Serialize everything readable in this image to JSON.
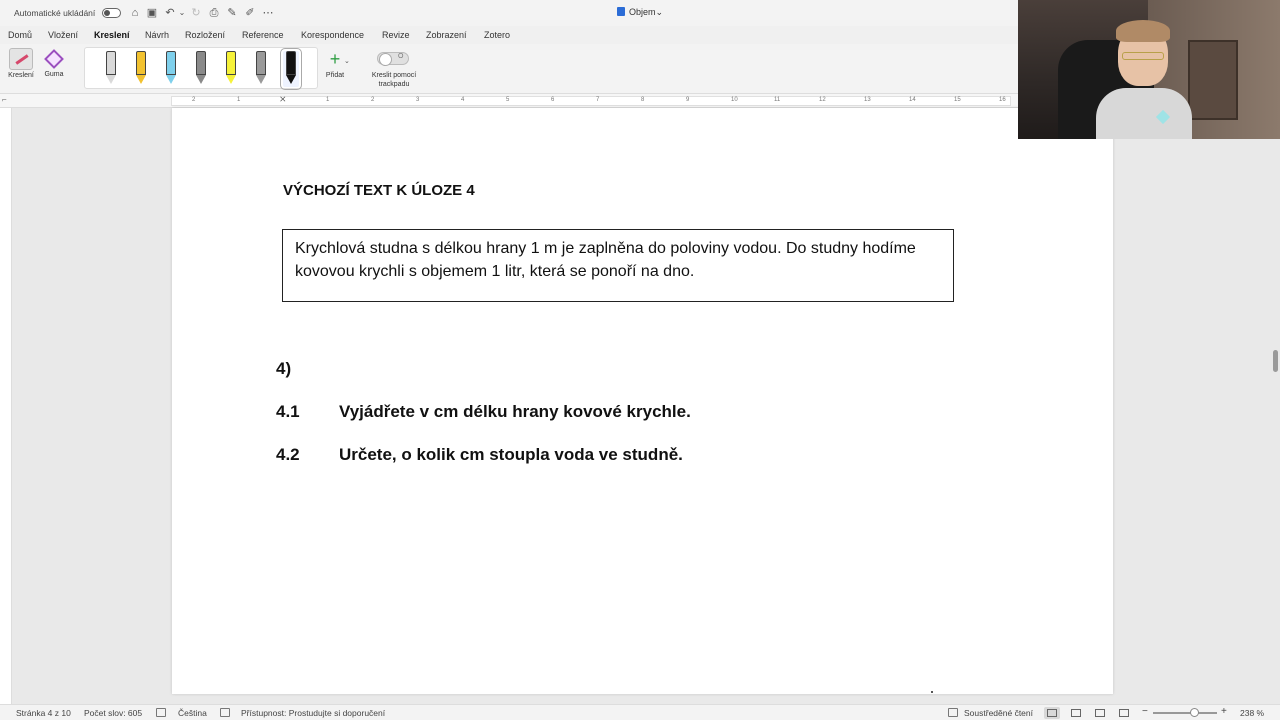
{
  "titlebar": {
    "autosave_label": "Automatické ukládání",
    "document_title": "Objem",
    "title_chevron": "⌄"
  },
  "ribbon_tabs": [
    {
      "label": "Domů"
    },
    {
      "label": "Vložení"
    },
    {
      "label": "Kreslení"
    },
    {
      "label": "Návrh"
    },
    {
      "label": "Rozložení"
    },
    {
      "label": "Reference"
    },
    {
      "label": "Korespondence"
    },
    {
      "label": "Revize"
    },
    {
      "label": "Zobrazení"
    },
    {
      "label": "Zotero"
    }
  ],
  "ribbon": {
    "drawing_label": "Kreslení",
    "eraser_label": "Guma",
    "add_label": "Přidat",
    "trackpad_label": "Kreslit pomocí trackpadu",
    "trackpad_state": "O",
    "pens": [
      {
        "color": "#d9d9d9"
      },
      {
        "color": "#f2c230"
      },
      {
        "color": "#7fd0ec"
      },
      {
        "color": "#8a8a8a"
      },
      {
        "color": "#f6f23a"
      },
      {
        "color": "#9a9a9a"
      },
      {
        "color": "#111111"
      }
    ]
  },
  "ruler": {
    "numbers": [
      "2",
      "1",
      "1",
      "2",
      "3",
      "4",
      "5",
      "6",
      "7",
      "8",
      "9",
      "10",
      "11",
      "12",
      "13",
      "14",
      "15",
      "16"
    ]
  },
  "document": {
    "heading": "VÝCHOZÍ TEXT K ÚLOZE 4",
    "box_text": "Krychlová studna s délkou hrany 1 m je zaplněna do poloviny vodou. Do studny hodíme kovovou krychli s objemem 1 litr, která se ponoří na dno.",
    "task_number": "4)",
    "questions": [
      {
        "number": "4.1",
        "text": "Vyjádřete v cm délku hrany kovové krychle."
      },
      {
        "number": "4.2",
        "text": "Určete, o kolik cm stoupla voda ve studně."
      }
    ]
  },
  "statusbar": {
    "page": "Stránka 4 z 10",
    "word_count": "Počet slov: 605",
    "language": "Čeština",
    "accessibility": "Přístupnost: Prostudujte si doporučení",
    "focus": "Soustředěné čtení",
    "zoom_minus": "−",
    "zoom_plus": "+",
    "zoom": "238 %"
  },
  "colors": {
    "accent": "#2b6cd6",
    "add_green": "#2f9e44",
    "eraser_purple": "#9b4fbf"
  }
}
